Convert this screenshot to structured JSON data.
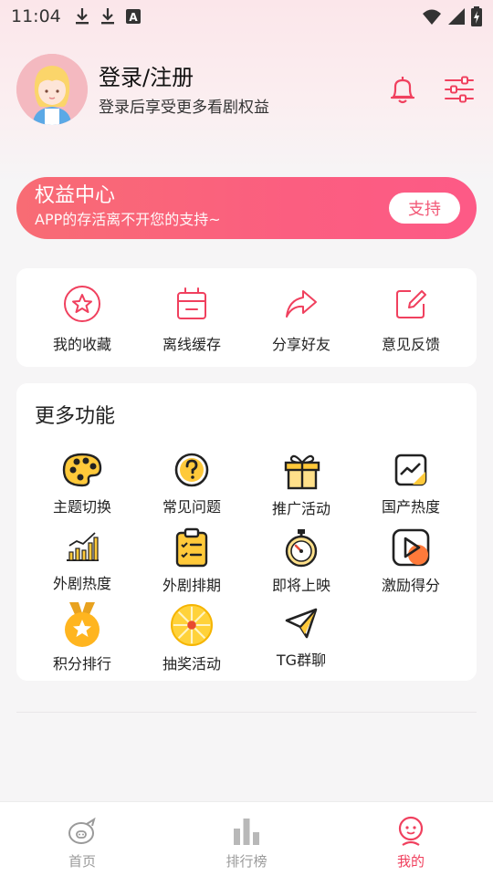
{
  "status_bar": {
    "time": "11:04",
    "icons_left": [
      "download-icon",
      "download-icon",
      "text-a-icon"
    ],
    "icons_right": [
      "wifi-icon",
      "signal-icon",
      "battery-charging-icon"
    ]
  },
  "profile": {
    "title": "登录/注册",
    "subtitle": "登录后享受更多看剧权益",
    "actions": [
      "bell-icon",
      "sliders-icon"
    ]
  },
  "rights": {
    "title": "权益中心",
    "subtitle": "APP的存活离不开您的支持~",
    "button_label": "支持"
  },
  "quick_actions": [
    {
      "label": "我的收藏",
      "icon": "star-icon"
    },
    {
      "label": "离线缓存",
      "icon": "cache-icon"
    },
    {
      "label": "分享好友",
      "icon": "share-icon"
    },
    {
      "label": "意见反馈",
      "icon": "edit-icon"
    }
  ],
  "more": {
    "title": "更多功能",
    "items": [
      {
        "label": "主题切换",
        "icon": "palette-icon"
      },
      {
        "label": "常见问题",
        "icon": "question-icon"
      },
      {
        "label": "推广活动",
        "icon": "gift-icon"
      },
      {
        "label": "国产热度",
        "icon": "trend-icon"
      },
      {
        "label": "外剧热度",
        "icon": "bar-chart-icon"
      },
      {
        "label": "外剧排期",
        "icon": "clipboard-icon"
      },
      {
        "label": "即将上映",
        "icon": "stopwatch-icon"
      },
      {
        "label": "激励得分",
        "icon": "play-icon"
      },
      {
        "label": "积分排行",
        "icon": "medal-icon"
      },
      {
        "label": "抽奖活动",
        "icon": "lottery-wheel-icon"
      },
      {
        "label": "TG群聊",
        "icon": "telegram-icon"
      }
    ]
  },
  "bottom_nav": [
    {
      "label": "首页",
      "icon": "home-icon",
      "active": false
    },
    {
      "label": "排行榜",
      "icon": "ranking-icon",
      "active": false
    },
    {
      "label": "我的",
      "icon": "mine-icon",
      "active": true
    }
  ],
  "colors": {
    "accent": "#f0405e",
    "banner_start": "#f86c74",
    "banner_end": "#fd5a86",
    "icon_yellow": "#ffc93a"
  }
}
